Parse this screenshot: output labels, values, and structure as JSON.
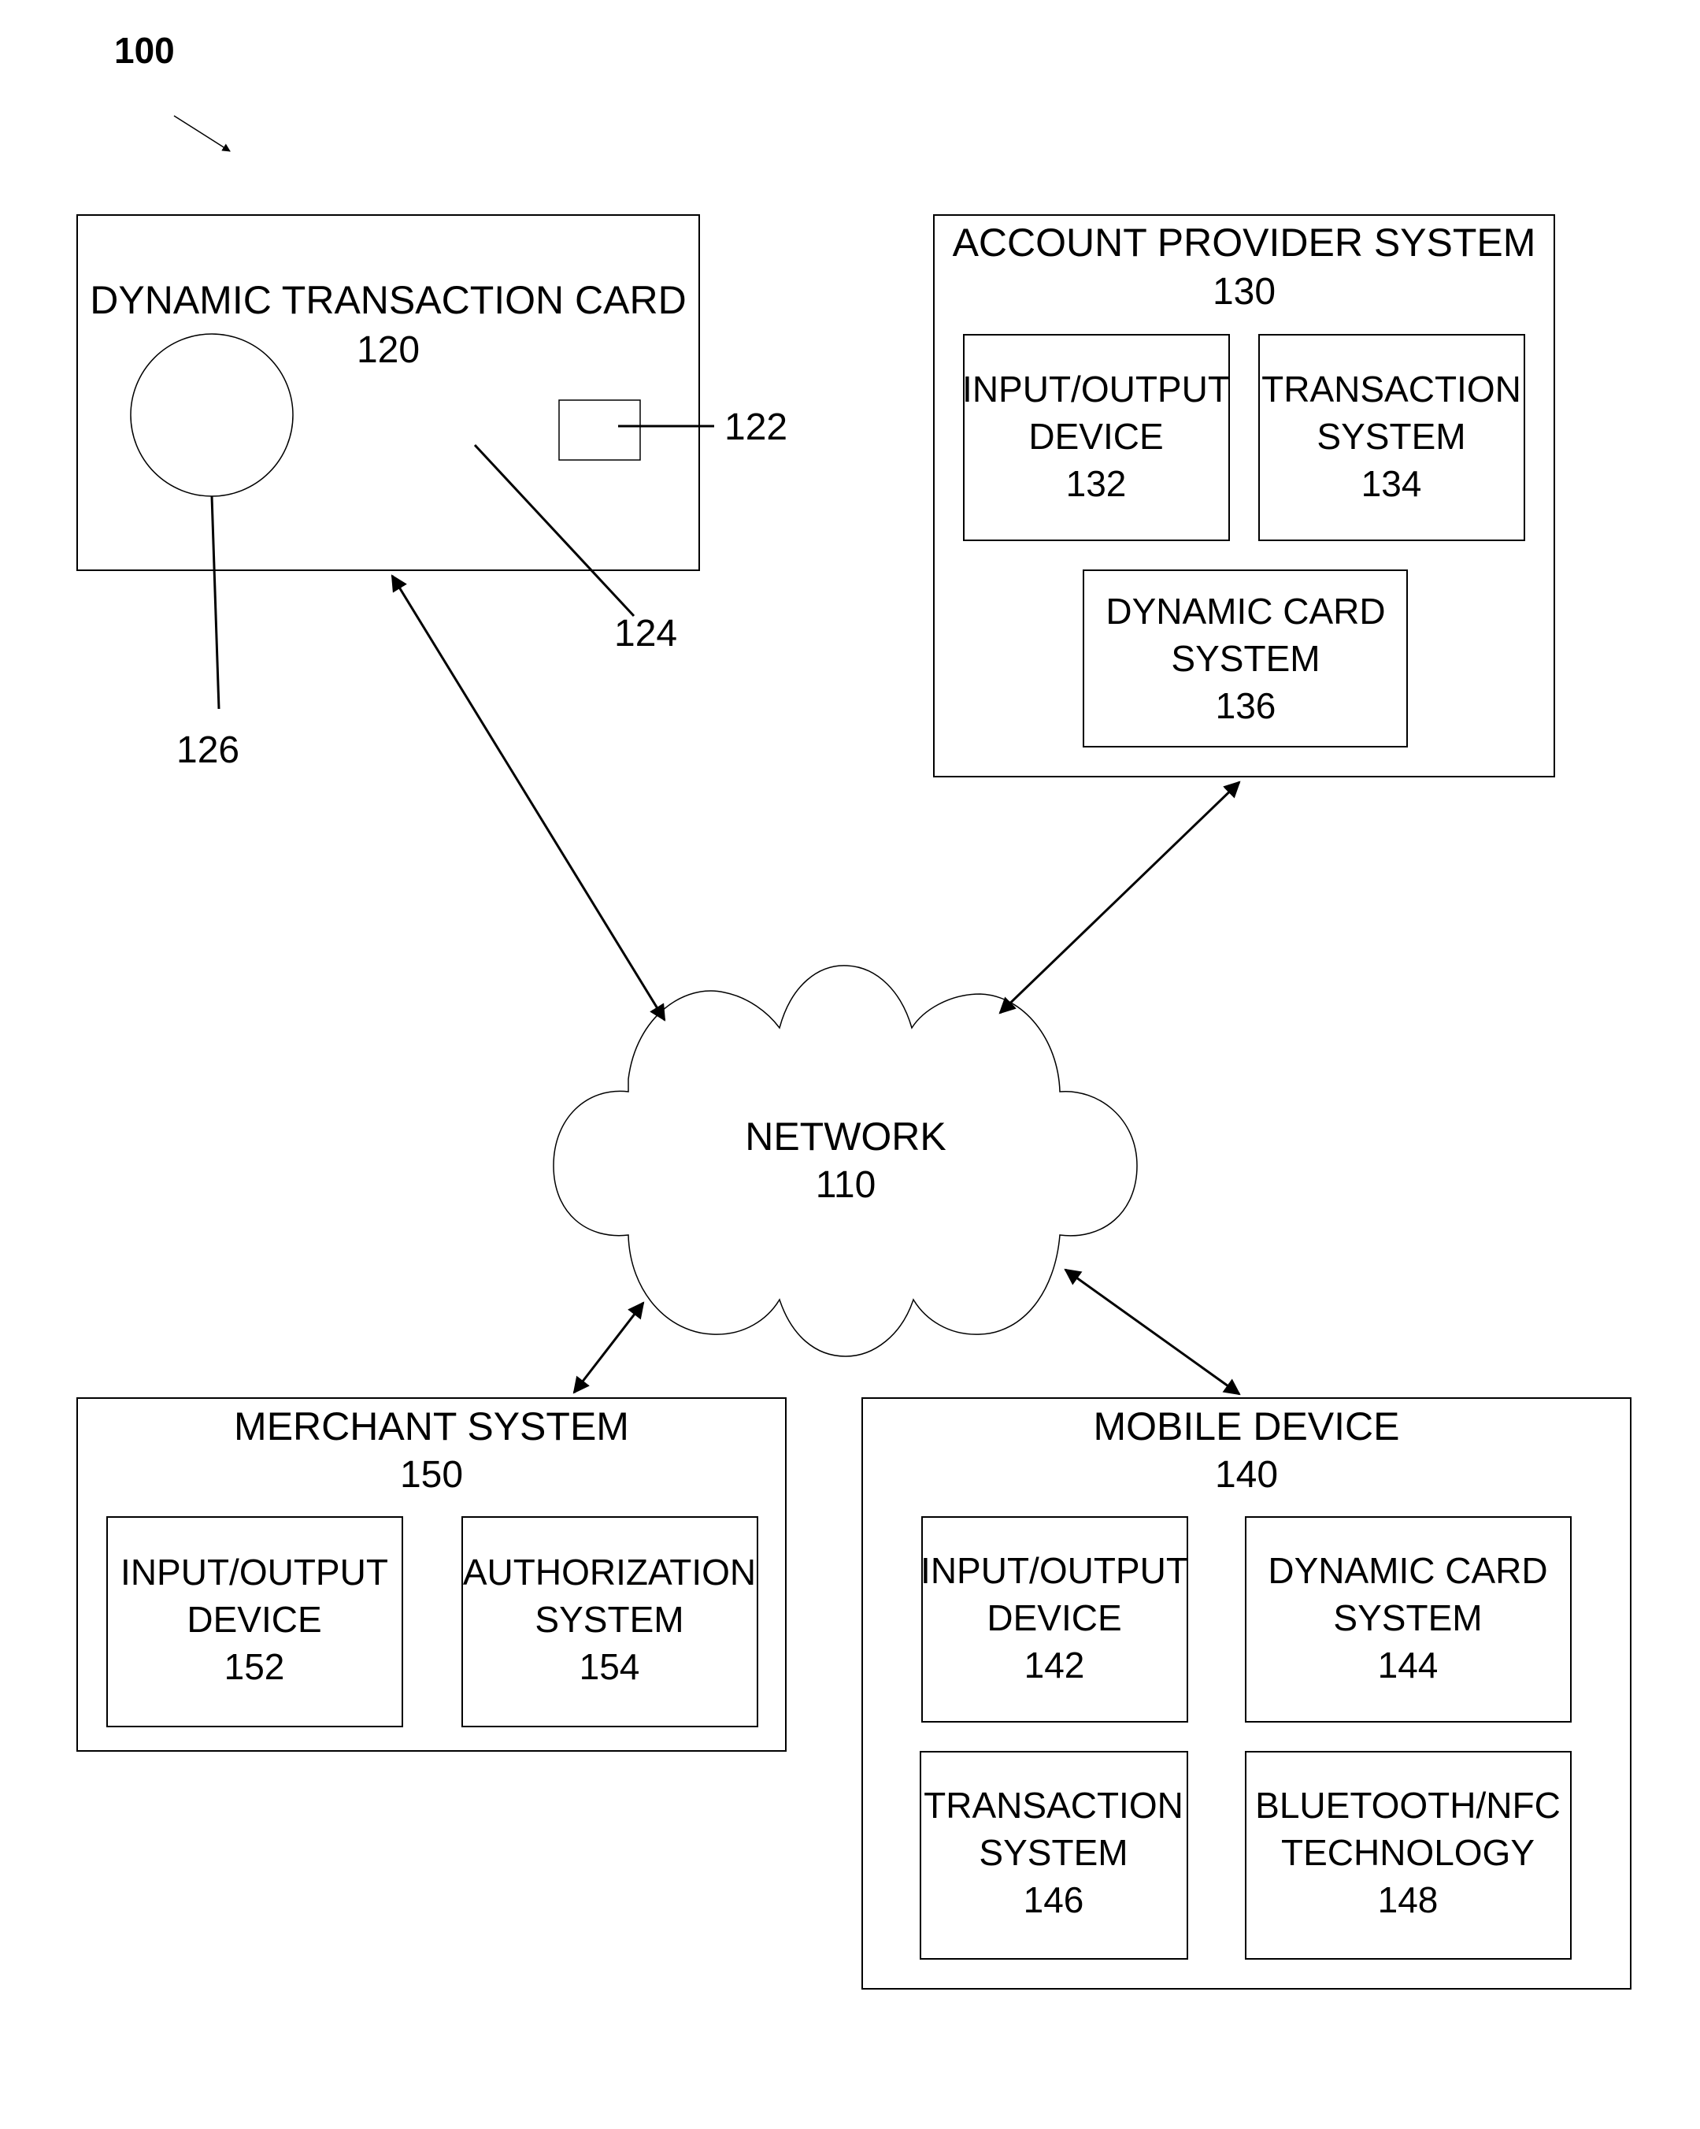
{
  "figure": {
    "label": "100"
  },
  "network": {
    "name": "NETWORK",
    "ref": "110"
  },
  "card": {
    "name": "DYNAMIC TRANSACTION CARD",
    "ref": "120",
    "callouts": {
      "chip": "122",
      "body": "124",
      "antenna": "126"
    }
  },
  "account_provider": {
    "name": "ACCOUNT PROVIDER SYSTEM",
    "ref": "130",
    "components": [
      {
        "lines": [
          "INPUT/OUTPUT",
          "DEVICE"
        ],
        "ref": "132"
      },
      {
        "lines": [
          "TRANSACTION",
          "SYSTEM"
        ],
        "ref": "134"
      },
      {
        "lines": [
          "DYNAMIC CARD",
          "SYSTEM"
        ],
        "ref": "136"
      }
    ]
  },
  "merchant": {
    "name": "MERCHANT SYSTEM",
    "ref": "150",
    "components": [
      {
        "lines": [
          "INPUT/OUTPUT",
          "DEVICE"
        ],
        "ref": "152"
      },
      {
        "lines": [
          "AUTHORIZATION",
          "SYSTEM"
        ],
        "ref": "154"
      }
    ]
  },
  "mobile": {
    "name": "MOBILE DEVICE",
    "ref": "140",
    "components": [
      {
        "lines": [
          "INPUT/OUTPUT",
          "DEVICE"
        ],
        "ref": "142"
      },
      {
        "lines": [
          "DYNAMIC CARD",
          "SYSTEM"
        ],
        "ref": "144"
      },
      {
        "lines": [
          "TRANSACTION",
          "SYSTEM"
        ],
        "ref": "146"
      },
      {
        "lines": [
          "BLUETOOTH/NFC",
          "TECHNOLOGY"
        ],
        "ref": "148"
      }
    ]
  },
  "connections": [
    {
      "from": "card",
      "to": "network",
      "type": "bidirectional"
    },
    {
      "from": "account_provider",
      "to": "network",
      "type": "bidirectional"
    },
    {
      "from": "merchant",
      "to": "network",
      "type": "bidirectional"
    },
    {
      "from": "mobile",
      "to": "network",
      "type": "bidirectional"
    }
  ]
}
